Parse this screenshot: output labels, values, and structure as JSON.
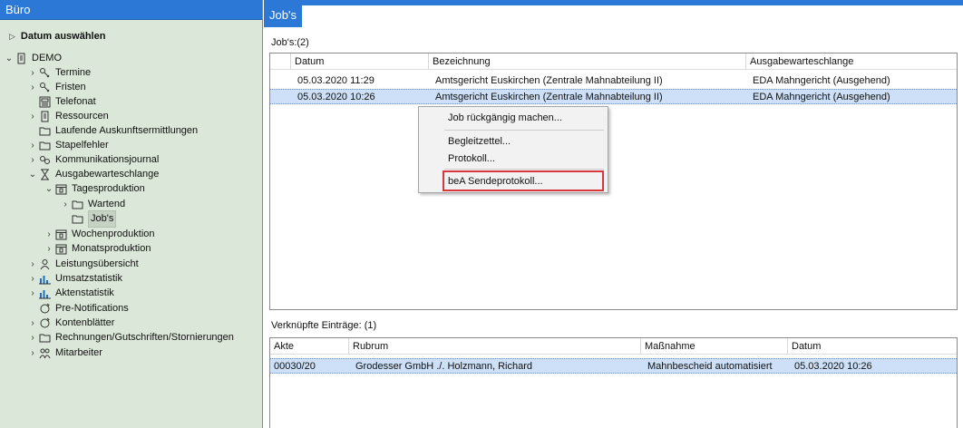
{
  "left_panel": {
    "title": "Büro",
    "datum_label": "Datum auswählen",
    "tree": [
      {
        "label": "DEMO",
        "chevron": "down",
        "icon": "document-icon"
      },
      {
        "label": "Termine",
        "chevron": "right",
        "icon": "key-icon"
      },
      {
        "label": "Fristen",
        "chevron": "right",
        "icon": "key-icon"
      },
      {
        "label": "Telefonat",
        "chevron": "",
        "icon": "phone-icon"
      },
      {
        "label": "Ressourcen",
        "chevron": "right",
        "icon": "document-icon"
      },
      {
        "label": "Laufende Auskunftsermittlungen",
        "chevron": "",
        "icon": "folder-icon"
      },
      {
        "label": "Stapelfehler",
        "chevron": "right",
        "icon": "folder-icon"
      },
      {
        "label": "Kommunikationsjournal",
        "chevron": "right",
        "icon": "link-icon"
      },
      {
        "label": "Ausgabewarteschlange",
        "chevron": "down",
        "icon": "hourglass-icon"
      },
      {
        "label": "Tagesproduktion",
        "chevron": "down",
        "icon": "calendar-icon"
      },
      {
        "label": "Wartend",
        "chevron": "right",
        "icon": "folder-icon"
      },
      {
        "label": "Job's",
        "chevron": "",
        "icon": "folder-icon"
      },
      {
        "label": "Wochenproduktion",
        "chevron": "right",
        "icon": "calendar-icon"
      },
      {
        "label": "Monatsproduktion",
        "chevron": "right",
        "icon": "calendar-icon"
      },
      {
        "label": "Leistungsübersicht",
        "chevron": "right",
        "icon": "person-icon"
      },
      {
        "label": "Umsatzstatistik",
        "chevron": "right",
        "icon": "chart-icon"
      },
      {
        "label": "Aktenstatistik",
        "chevron": "right",
        "icon": "chart-icon"
      },
      {
        "label": "Pre-Notifications",
        "chevron": "",
        "icon": "cycle-icon"
      },
      {
        "label": "Kontenblätter",
        "chevron": "right",
        "icon": "cycle-icon"
      },
      {
        "label": "Rechnungen/Gutschriften/Stornierungen",
        "chevron": "right",
        "icon": "folder-icon"
      },
      {
        "label": "Mitarbeiter",
        "chevron": "right",
        "icon": "people-icon"
      }
    ]
  },
  "right_panel": {
    "tab_title": "Job's",
    "jobs_label": "Job's:(2)",
    "jobs_columns": [
      "Datum",
      "Bezeichnung",
      "Ausgabewarteschlange"
    ],
    "jobs_rows": [
      {
        "datum": "05.03.2020  11:29",
        "bezeichnung": "Amtsgericht Euskirchen (Zentrale Mahnabteilung II)",
        "queue": "EDA Mahngericht (Ausgehend)"
      },
      {
        "datum": "05.03.2020  10:26",
        "bezeichnung": "Amtsgericht Euskirchen (Zentrale Mahnabteilung II)",
        "queue": "EDA Mahngericht (Ausgehend)"
      }
    ],
    "context_menu": {
      "items": [
        "Job rückgängig machen...",
        "Begleitzettel...",
        "Protokoll...",
        "beA Sendeprotokoll..."
      ]
    },
    "linked_label": "Verknüpfte Einträge: (1)",
    "linked_columns": [
      "Akte",
      "Rubrum",
      "Maßnahme",
      "Datum"
    ],
    "linked_rows": [
      {
        "akte": "00030/20",
        "rubrum": "Grodesser GmbH ./. Holzmann, Richard",
        "massnahme": "Mahnbescheid automatisiert",
        "datum": "05.03.2020  10:26"
      }
    ]
  },
  "colors": {
    "header_blue": "#2b78d6",
    "sidebar_bg": "#dbe7d8",
    "selection": "#cde0f7",
    "highlight_red": "#d8373c"
  }
}
